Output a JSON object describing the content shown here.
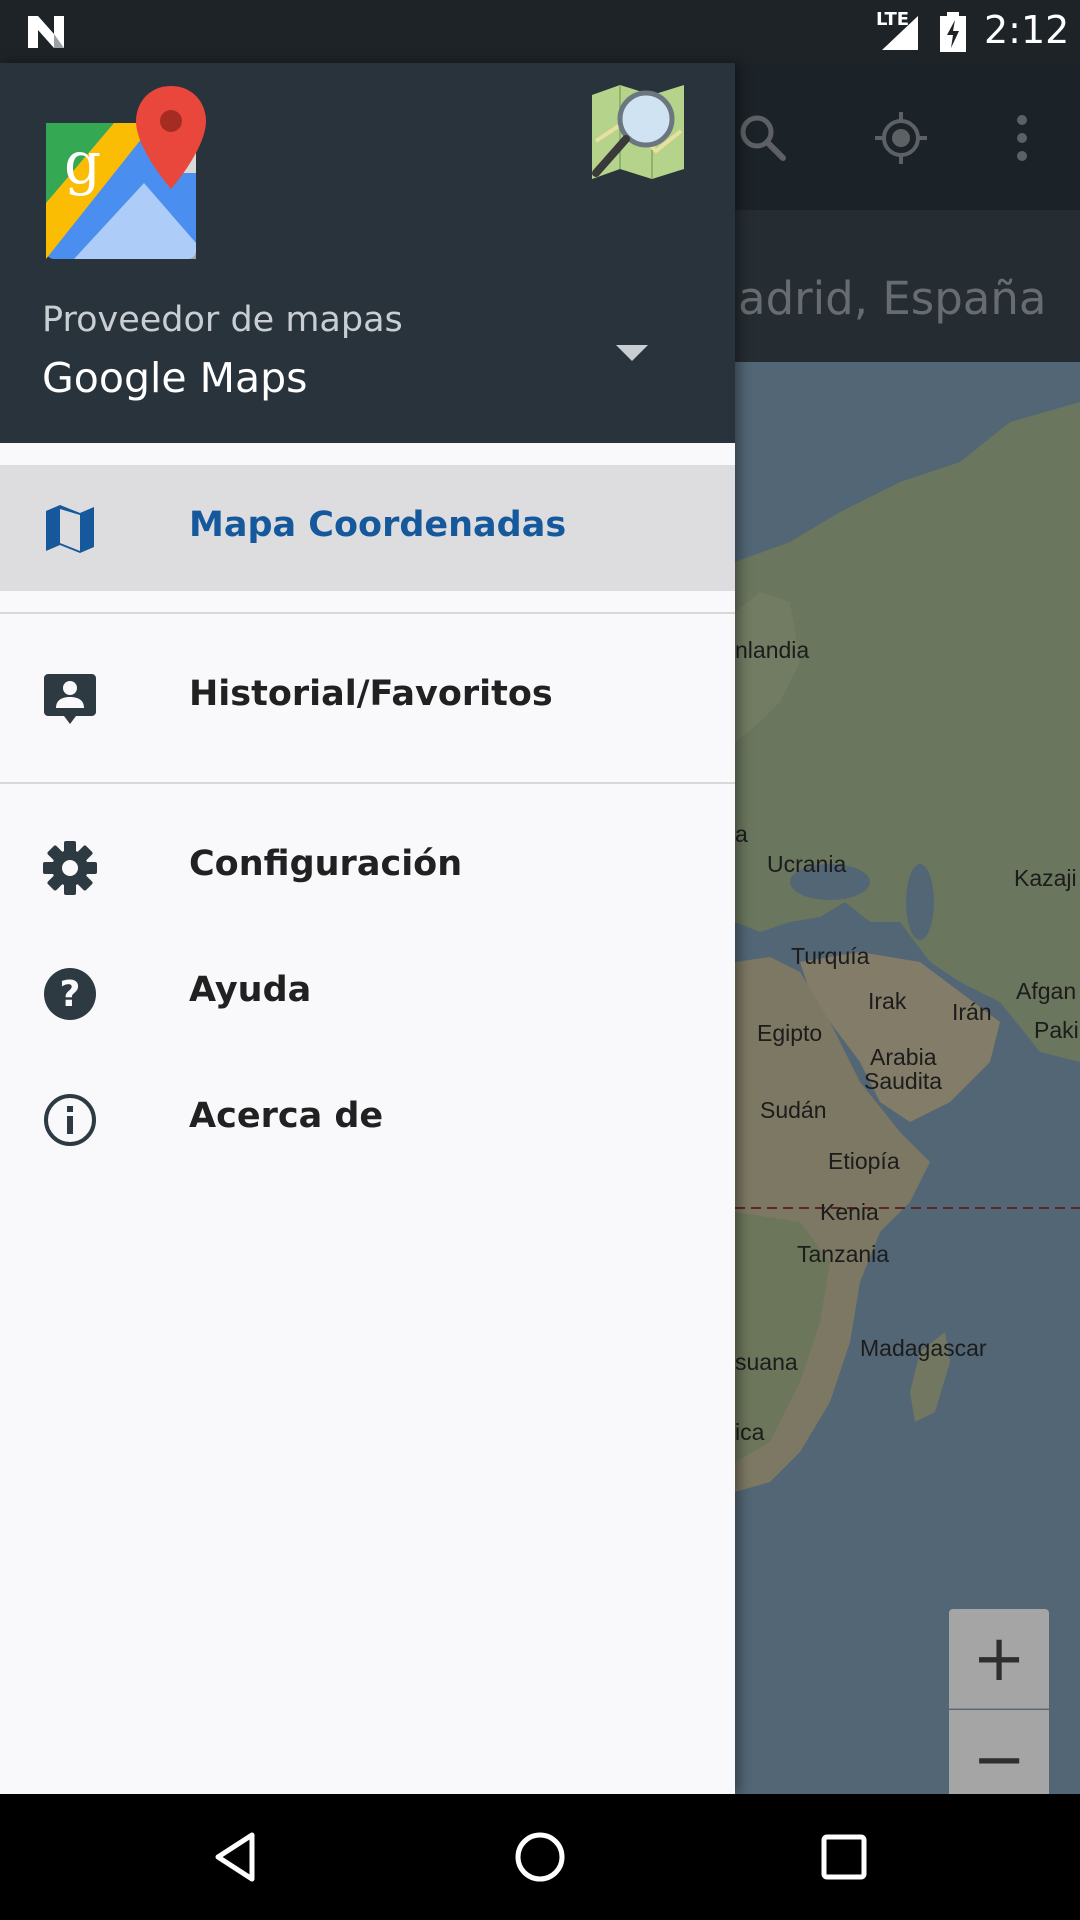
{
  "status_bar": {
    "network_label": "LTE",
    "time": "2:12"
  },
  "app": {
    "search_text": "adrid, España",
    "toolbar_icons": [
      "search-icon",
      "my-location-icon",
      "more-vert-icon"
    ],
    "zoom_in_label": "+",
    "zoom_out_label": "−"
  },
  "map": {
    "labels": [
      "nlandia",
      "Ucrania",
      "Kazaji",
      "Turquía",
      "Irak",
      "Irán",
      "Afgan",
      "Paki",
      "Egipto",
      "Arabia",
      "Saudita",
      "Sudán",
      "Etiopía",
      "Kenia",
      "Tanzania",
      "Madagascar",
      "suana",
      "ica",
      "a"
    ]
  },
  "drawer": {
    "provider_caption": "Proveedor de mapas",
    "provider_value": "Google Maps",
    "items": [
      {
        "label": "Mapa Coordenadas",
        "icon": "map-icon",
        "active": true
      },
      {
        "label": "Historial/Favoritos",
        "icon": "contact-history-icon",
        "active": false
      },
      {
        "label": "Configuración",
        "icon": "gear-icon",
        "active": false
      },
      {
        "label": "Ayuda",
        "icon": "help-icon",
        "active": false
      },
      {
        "label": "Acerca de",
        "icon": "info-icon",
        "active": false
      }
    ]
  },
  "colors": {
    "header": "#29333c",
    "active_text": "#15589b",
    "drawer_bg": "#f9f9fb",
    "active_bg": "#dddddf"
  }
}
